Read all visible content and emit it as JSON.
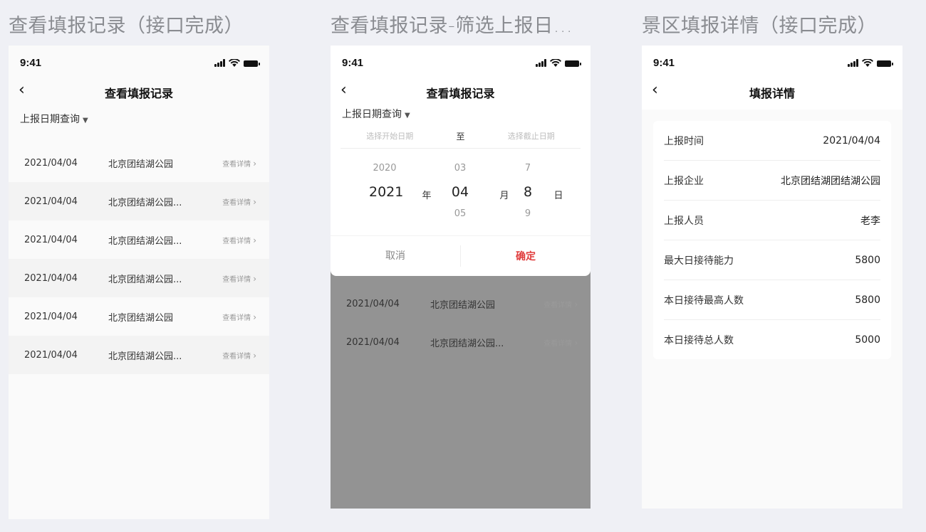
{
  "boards": [
    {
      "title": "查看填报记录（接口完成）"
    },
    {
      "title": "查看填报记录-筛选上报日..."
    },
    {
      "title": "景区填报详情（接口完成）"
    }
  ],
  "status": {
    "time": "9:41"
  },
  "nav_icons": {
    "back": "chevron-left-icon",
    "caret": "caret-down-icon"
  },
  "list_screen": {
    "title": "查看填报记录",
    "filter_label": "上报日期查询",
    "rows": [
      {
        "date": "2021/04/04",
        "name": "北京团结湖公园",
        "action": "查看详情"
      },
      {
        "date": "2021/04/04",
        "name": "北京团结湖公园...",
        "action": "查看详情"
      },
      {
        "date": "2021/04/04",
        "name": "北京团结湖公园...",
        "action": "查看详情"
      },
      {
        "date": "2021/04/04",
        "name": "北京团结湖公园...",
        "action": "查看详情"
      },
      {
        "date": "2021/04/04",
        "name": "北京团结湖公园",
        "action": "查看详情"
      },
      {
        "date": "2021/04/04",
        "name": "北京团结湖公园...",
        "action": "查看详情"
      }
    ]
  },
  "filter_screen": {
    "title": "查看填报记录",
    "filter_label": "上报日期查询",
    "start_placeholder": "选择开始日期",
    "to_label": "至",
    "end_placeholder": "选择截止日期",
    "picker": {
      "year": {
        "prev": "2020",
        "current": "2021",
        "unit": "年"
      },
      "month": {
        "prev": "03",
        "current": "04",
        "next": "05",
        "unit": "月"
      },
      "day": {
        "prev": "7",
        "current": "8",
        "next": "9",
        "unit": "日"
      }
    },
    "cancel_label": "取消",
    "confirm_label": "确定",
    "rows": [
      {
        "date": "2021/04/04",
        "name": "北京团结湖公园",
        "action": "查看详情"
      },
      {
        "date": "2021/04/04",
        "name": "北京团结湖公园...",
        "action": "查看详情"
      }
    ]
  },
  "detail_screen": {
    "title": "填报详情",
    "fields": [
      {
        "label": "上报时间",
        "value": "2021/04/04"
      },
      {
        "label": "上报企业",
        "value": "北京团结湖团结湖公园"
      },
      {
        "label": "上报人员",
        "value": "老李"
      },
      {
        "label": "最大日接待能力",
        "value": "5800"
      },
      {
        "label": "本日接待最高人数",
        "value": "5800"
      },
      {
        "label": "本日接待总人数",
        "value": "5000"
      }
    ]
  },
  "colors": {
    "canvas": "#eff0f5",
    "accent_red": "#e03c3c",
    "overlay": "#939393"
  }
}
